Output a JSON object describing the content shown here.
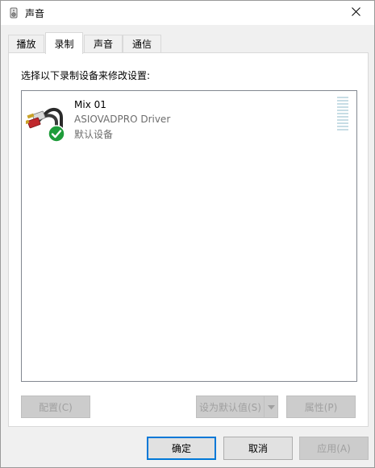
{
  "window": {
    "title": "声音"
  },
  "tabs": [
    {
      "label": "播放"
    },
    {
      "label": "录制"
    },
    {
      "label": "声音"
    },
    {
      "label": "通信"
    }
  ],
  "recording": {
    "instruction": "选择以下录制设备来修改设置:",
    "devices": [
      {
        "name": "Mix 01",
        "driver": "ASIOVADPRO Driver",
        "status": "默认设备"
      }
    ]
  },
  "panel_buttons": {
    "configure": "配置(C)",
    "set_default": "设为默认值(S)",
    "properties": "属性(P)"
  },
  "dialog_buttons": {
    "ok": "确定",
    "cancel": "取消",
    "apply": "应用(A)"
  },
  "colors": {
    "accent": "#0078d7",
    "check_green": "#1e9c3a",
    "meter": "#c7dde5"
  },
  "icons": [
    "speaker-icon",
    "close-icon",
    "rca-cable-icon",
    "default-check-icon",
    "dropdown-arrow-icon"
  ]
}
